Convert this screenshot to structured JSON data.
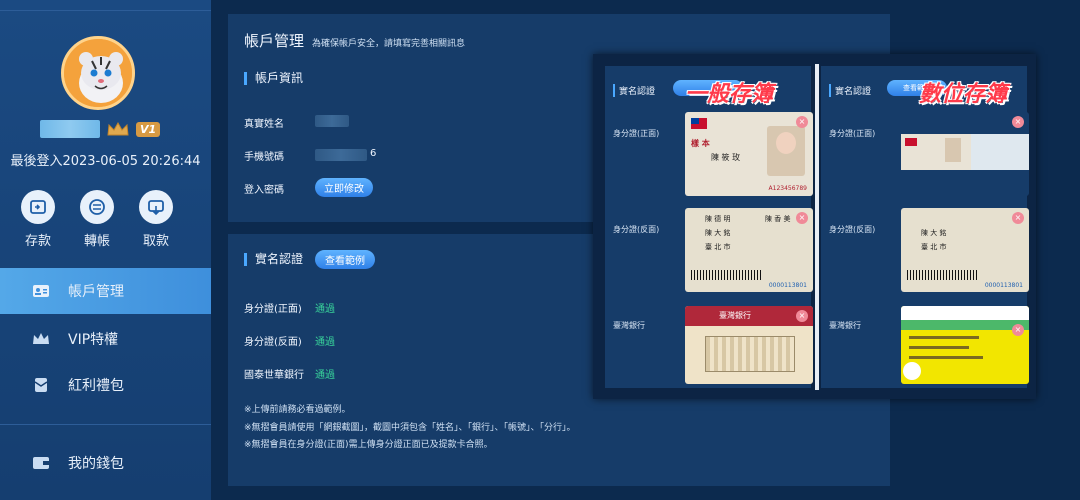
{
  "sidebar": {
    "vip_level": "V1",
    "last_login": "最後登入2023-06-05 20:26:44",
    "quick_actions": [
      {
        "label": "存款",
        "icon": "deposit-icon"
      },
      {
        "label": "轉帳",
        "icon": "transfer-icon"
      },
      {
        "label": "取款",
        "icon": "withdraw-icon"
      }
    ],
    "menu": [
      {
        "label": "帳戶管理",
        "icon": "id-card-icon",
        "active": true
      },
      {
        "label": "VIP特權",
        "icon": "crown-icon",
        "active": false
      },
      {
        "label": "紅利禮包",
        "icon": "envelope-icon",
        "active": false
      },
      {
        "label": "我的錢包",
        "icon": "wallet-icon",
        "active": false
      }
    ]
  },
  "account": {
    "title": "帳戶管理",
    "hint": "為確保帳戶安全，請填寫完善相關訊息",
    "info_section": "帳戶資訊",
    "rows": {
      "real_name_label": "真實姓名",
      "phone_label": "手機號碼",
      "phone_suffix": "6",
      "password_label": "登入密碼",
      "password_button": "立即修改"
    }
  },
  "verify": {
    "section": "實名認證",
    "example_button": "查看範例",
    "items": [
      {
        "label": "身分證(正面)",
        "status": "通過"
      },
      {
        "label": "身分證(反面)",
        "status": "通過"
      },
      {
        "label": "國泰世華銀行",
        "status": "通過"
      }
    ],
    "notes": [
      "※上傳前請務必看過範例。",
      "※無摺會員請使用「網銀截圖」，截圖中須包含「姓名」、「銀行」、「帳號」、「分行」。",
      "※無摺會員在身分證(正面)需上傳身分證正面已及提款卡合照。"
    ]
  },
  "example": {
    "left": {
      "section": "實名認證",
      "big_title": "一般存簿",
      "labels": [
        "身分證(正面)",
        "身分證(反面)",
        "臺灣銀行"
      ]
    },
    "right": {
      "section": "實名認證",
      "pill": "查看範例",
      "big_title": "數位存簿",
      "labels": [
        "身分證(正面)",
        "身分證(反面)",
        "臺灣銀行"
      ]
    },
    "card_text": {
      "id_front_name": "陳 筱 玫",
      "id_back_name": "陳 德 明",
      "id_back_father": "陳 大 銘",
      "id_back_mother": "陳 香 美",
      "id_back_city": "臺 北 市",
      "bank_name": "臺灣銀行",
      "id_number": "A123456789",
      "barcode_number": "0000113801",
      "sample_stamp": "樣 本"
    },
    "colors": {
      "accent": "#ff3a4a",
      "pill": "#2f80e8",
      "status": "#38d39a"
    }
  }
}
